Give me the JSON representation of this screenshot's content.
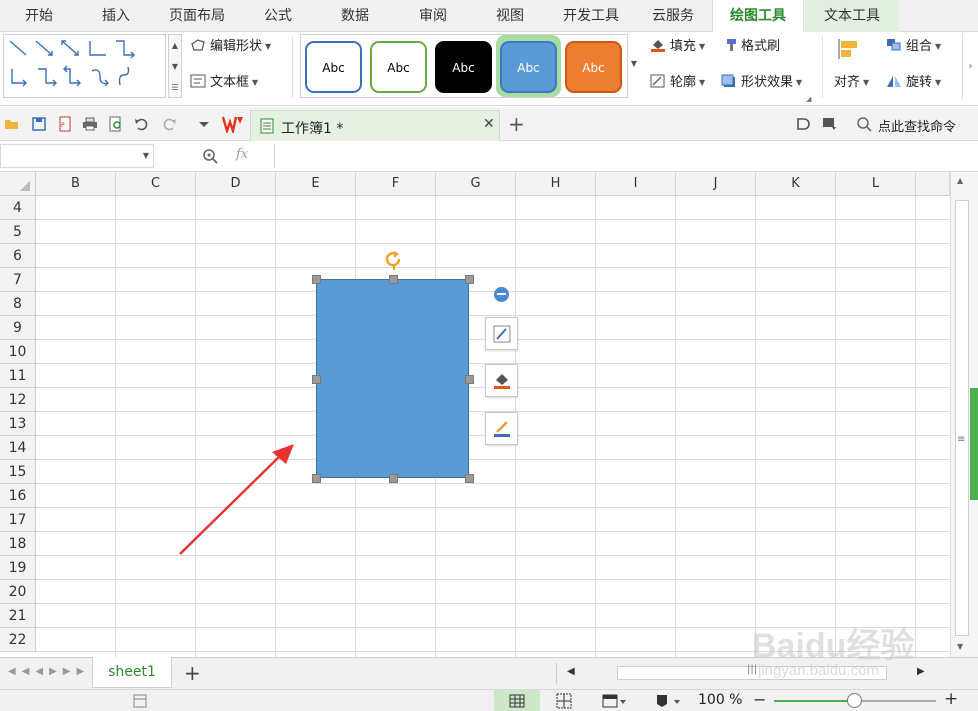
{
  "menu": {
    "tabs": [
      {
        "label": "开始"
      },
      {
        "label": "插入"
      },
      {
        "label": "页面布局"
      },
      {
        "label": "公式"
      },
      {
        "label": "数据"
      },
      {
        "label": "审阅"
      },
      {
        "label": "视图"
      },
      {
        "label": "开发工具"
      },
      {
        "label": "云服务"
      },
      {
        "label": "绘图工具",
        "active": true
      },
      {
        "label": "文本工具"
      }
    ]
  },
  "ribbon": {
    "edit_shape": "编辑形状",
    "text_box": "文本框",
    "style_presets": [
      "Abc",
      "Abc",
      "Abc",
      "Abc",
      "Abc"
    ],
    "fill": "填充",
    "format_painter": "格式刷",
    "outline": "轮廓",
    "shape_effects": "形状效果",
    "align": "对齐",
    "group": "组合",
    "rotate": "旋转",
    "colors": {
      "style1_border": "#3d6ebd",
      "style2_border": "#6aaa3e",
      "style3_fill": "#000000",
      "style4_fill": "#5b9bd5",
      "style5_fill": "#ed7d31"
    }
  },
  "tabs_bar": {
    "document_title": "工作簿1 *",
    "search_commands": "点此查找命令"
  },
  "formula_bar": {
    "name_box": "",
    "fx_label": "fx",
    "formula": ""
  },
  "grid": {
    "columns": [
      "B",
      "C",
      "D",
      "E",
      "F",
      "G",
      "H",
      "I",
      "J",
      "K",
      "L"
    ],
    "rows": [
      "4",
      "5",
      "6",
      "7",
      "8",
      "9",
      "10",
      "11",
      "12",
      "13",
      "14",
      "15",
      "16",
      "17",
      "18",
      "19",
      "20",
      "21",
      "22"
    ]
  },
  "shape": {
    "fill": "#5b9bd5",
    "selected": true
  },
  "sheets": {
    "tabs": [
      "sheet1"
    ]
  },
  "status": {
    "zoom": "100 %",
    "zoom_level": 0.5
  },
  "watermark": {
    "main": "Baidu经验",
    "sub": "jingyan.baidu.com"
  }
}
